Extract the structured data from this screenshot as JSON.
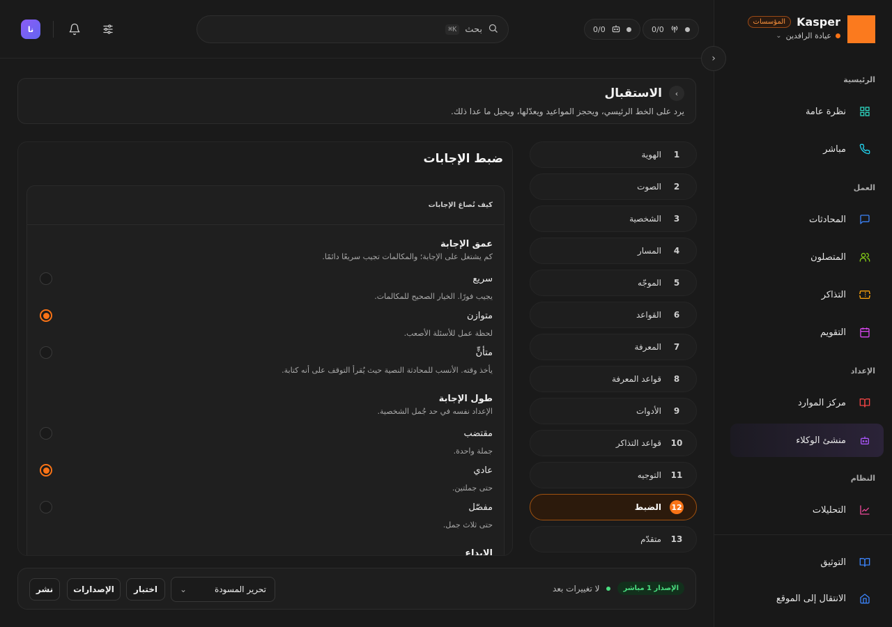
{
  "brand": {
    "name": "Kasper",
    "badge": "المؤسسات",
    "org": "عيادة الرافدين"
  },
  "topbar": {
    "avatar_initials": "نا",
    "search_label": "بحث",
    "search_shortcut": "⌘K",
    "counter_a": "0/0",
    "counter_b": "0/0"
  },
  "sidebar": {
    "sections": {
      "main": "الرئيسية",
      "work": "العمل",
      "setup": "الإعداد",
      "system": "النظام"
    },
    "items": {
      "overview": "نظرة عامة",
      "live": "مباشر",
      "conversations": "المحادثات",
      "callers": "المتصلون",
      "tickets": "التذاكر",
      "calendar": "التقويم",
      "resources": "مركز الموارد",
      "agent_builder": "منشئ الوكلاء",
      "analytics": "التحليلات",
      "docs": "التوثيق",
      "go_to_site": "الانتقال إلى الموقع"
    }
  },
  "header": {
    "title": "الاستقبال",
    "description": "يرد على الخط الرئيسي، ويحجز المواعيد ويعدّلها، ويحيل ما عدا ذلك."
  },
  "steps": [
    {
      "num": "1",
      "label": "الهوية"
    },
    {
      "num": "2",
      "label": "الصوت"
    },
    {
      "num": "3",
      "label": "الشخصية"
    },
    {
      "num": "4",
      "label": "المسار"
    },
    {
      "num": "5",
      "label": "الموجّه"
    },
    {
      "num": "6",
      "label": "القواعد"
    },
    {
      "num": "7",
      "label": "المعرفة"
    },
    {
      "num": "8",
      "label": "قواعد المعرفة"
    },
    {
      "num": "9",
      "label": "الأدوات"
    },
    {
      "num": "10",
      "label": "قواعد التذاكر"
    },
    {
      "num": "11",
      "label": "التوجيه"
    },
    {
      "num": "12",
      "label": "الضبط"
    },
    {
      "num": "13",
      "label": "متقدّم"
    }
  ],
  "active_step": "12",
  "panel": {
    "title": "ضبط الإجابات",
    "section_header": "كيف تُصاغ الإجابات",
    "depth": {
      "title": "عمق الإجابة",
      "desc": "كم يشتغل على الإجابة؛ والمكالمات تجيب سريعًا دائمًا.",
      "options": [
        {
          "label": "سريع",
          "desc": "يجيب فورًا. الخيار الصحيح للمكالمات.",
          "selected": false
        },
        {
          "label": "متوازن",
          "desc": "لحظة عمل للأسئلة الأصعب.",
          "selected": true
        },
        {
          "label": "متأنٍّ",
          "desc": "يأخذ وقته. الأنسب للمحادثة النصية حيث يُقرأ التوقف على أنه كتابة.",
          "selected": false
        }
      ]
    },
    "length": {
      "title": "طول الإجابة",
      "desc": "الإعداد نفسه في حد جُمل الشخصية.",
      "options": [
        {
          "label": "مقتضب",
          "desc": "جملة واحدة.",
          "selected": false
        },
        {
          "label": "عادي",
          "desc": "حتى جملتين.",
          "selected": true
        },
        {
          "label": "مفصّل",
          "desc": "حتى ثلاث جمل.",
          "selected": false
        }
      ]
    },
    "next_section_title": "الإبداع"
  },
  "bottombar": {
    "version_badge": "الإصدار 1 مباشر",
    "status_text": "لا تغييرات بعد",
    "draft_select": "تحرير المسودة",
    "test": "اختبار",
    "versions": "الإصدارات",
    "publish": "نشر"
  },
  "colors": {
    "accent": "#f97316",
    "brand_logo": "#fb7a1e",
    "live_green": "#4ade80"
  }
}
